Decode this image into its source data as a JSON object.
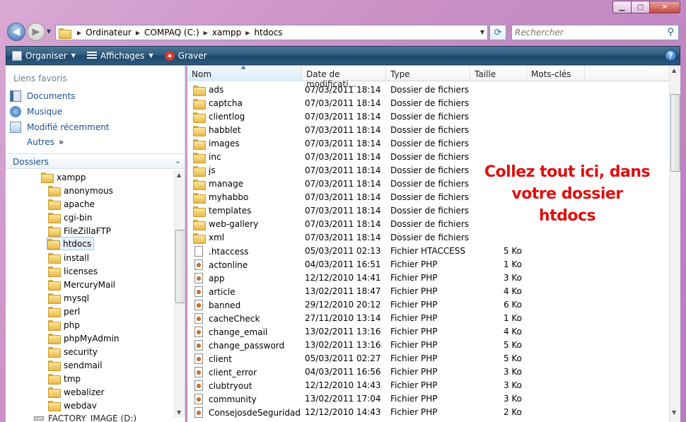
{
  "address": {
    "crumbs": [
      "Ordinateur",
      "COMPAQ (C:)",
      "xampp",
      "htdocs"
    ],
    "search_placeholder": "Rechercher"
  },
  "toolbar": {
    "organize": "Organiser",
    "views": "Affichages",
    "burn": "Graver",
    "help": "?"
  },
  "nav": {
    "favorites_header": "Liens favoris",
    "favorites": [
      "Documents",
      "Musique",
      "Modifié récemment"
    ],
    "more": "Autres",
    "more_chevron": "»",
    "folders_header": "Dossiers",
    "tree_root": "xampp",
    "tree": [
      "anonymous",
      "apache",
      "cgi-bin",
      "FileZillaFTP",
      "htdocs",
      "install",
      "licenses",
      "MercuryMail",
      "mysql",
      "perl",
      "php",
      "phpMyAdmin",
      "security",
      "sendmail",
      "tmp",
      "webalizer",
      "webdav"
    ],
    "selected": "htdocs",
    "bottom_drive": "FACTORY_IMAGE (D:)"
  },
  "columns": {
    "name": "Nom",
    "date": "Date de modificati...",
    "type": "Type",
    "size": "Taille",
    "tags": "Mots-clés"
  },
  "files": [
    {
      "name": "ads",
      "date": "07/03/2011 18:14",
      "type": "Dossier de fichiers",
      "size": "",
      "kind": "folder"
    },
    {
      "name": "captcha",
      "date": "07/03/2011 18:14",
      "type": "Dossier de fichiers",
      "size": "",
      "kind": "folder"
    },
    {
      "name": "clientlog",
      "date": "07/03/2011 18:14",
      "type": "Dossier de fichiers",
      "size": "",
      "kind": "folder"
    },
    {
      "name": "habblet",
      "date": "07/03/2011 18:14",
      "type": "Dossier de fichiers",
      "size": "",
      "kind": "folder"
    },
    {
      "name": "images",
      "date": "07/03/2011 18:14",
      "type": "Dossier de fichiers",
      "size": "",
      "kind": "folder"
    },
    {
      "name": "inc",
      "date": "07/03/2011 18:14",
      "type": "Dossier de fichiers",
      "size": "",
      "kind": "folder"
    },
    {
      "name": "js",
      "date": "07/03/2011 18:14",
      "type": "Dossier de fichiers",
      "size": "",
      "kind": "folder"
    },
    {
      "name": "manage",
      "date": "07/03/2011 18:14",
      "type": "Dossier de fichiers",
      "size": "",
      "kind": "folder"
    },
    {
      "name": "myhabbo",
      "date": "07/03/2011 18:14",
      "type": "Dossier de fichiers",
      "size": "",
      "kind": "folder"
    },
    {
      "name": "templates",
      "date": "07/03/2011 18:14",
      "type": "Dossier de fichiers",
      "size": "",
      "kind": "folder"
    },
    {
      "name": "web-gallery",
      "date": "07/03/2011 18:14",
      "type": "Dossier de fichiers",
      "size": "",
      "kind": "folder"
    },
    {
      "name": "xml",
      "date": "07/03/2011 18:14",
      "type": "Dossier de fichiers",
      "size": "",
      "kind": "folder"
    },
    {
      "name": ".htaccess",
      "date": "05/03/2011 02:13",
      "type": "Fichier HTACCESS",
      "size": "5 Ko",
      "kind": "file"
    },
    {
      "name": "actonline",
      "date": "04/03/2011 16:51",
      "type": "Fichier PHP",
      "size": "1 Ko",
      "kind": "php"
    },
    {
      "name": "app",
      "date": "12/12/2010 14:41",
      "type": "Fichier PHP",
      "size": "3 Ko",
      "kind": "php"
    },
    {
      "name": "article",
      "date": "13/02/2011 18:47",
      "type": "Fichier PHP",
      "size": "4 Ko",
      "kind": "php"
    },
    {
      "name": "banned",
      "date": "29/12/2010 20:12",
      "type": "Fichier PHP",
      "size": "6 Ko",
      "kind": "php"
    },
    {
      "name": "cacheCheck",
      "date": "27/11/2010 13:14",
      "type": "Fichier PHP",
      "size": "1 Ko",
      "kind": "php"
    },
    {
      "name": "change_email",
      "date": "13/02/2011 13:16",
      "type": "Fichier PHP",
      "size": "4 Ko",
      "kind": "php"
    },
    {
      "name": "change_password",
      "date": "13/02/2011 13:16",
      "type": "Fichier PHP",
      "size": "5 Ko",
      "kind": "php"
    },
    {
      "name": "client",
      "date": "05/03/2011 02:27",
      "type": "Fichier PHP",
      "size": "5 Ko",
      "kind": "php"
    },
    {
      "name": "client_error",
      "date": "04/03/2011 16:56",
      "type": "Fichier PHP",
      "size": "3 Ko",
      "kind": "php"
    },
    {
      "name": "clubtryout",
      "date": "12/12/2010 14:43",
      "type": "Fichier PHP",
      "size": "3 Ko",
      "kind": "php"
    },
    {
      "name": "community",
      "date": "13/02/2011 17:04",
      "type": "Fichier PHP",
      "size": "3 Ko",
      "kind": "php"
    },
    {
      "name": "ConsejosdeSeguridad",
      "date": "12/12/2010 14:43",
      "type": "Fichier PHP",
      "size": "2 Ko",
      "kind": "php"
    }
  ],
  "overlay": {
    "line1": "Collez tout ici, dans",
    "line2": "votre dossier htdocs"
  },
  "colors": {
    "overlay_text": "#e00f0f",
    "command_bar": "#2d5a7e",
    "link_blue": "#1c4f8f"
  }
}
